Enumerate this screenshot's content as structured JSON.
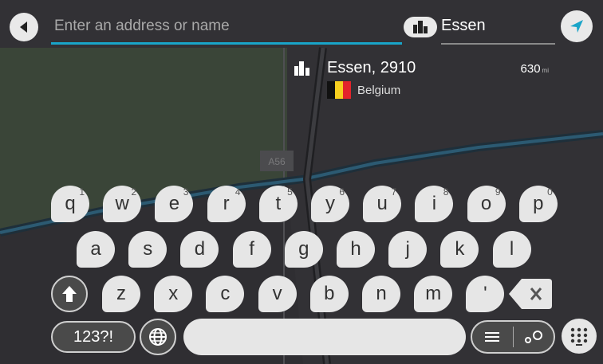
{
  "search": {
    "placeholder": "Enter an address or name"
  },
  "location": {
    "value": "Essen"
  },
  "result": {
    "title": "Essen, 2910",
    "country": "Belgium",
    "distance": "630",
    "distance_unit": "mi"
  },
  "map": {
    "road_label": "A56"
  },
  "keyboard": {
    "row1": [
      {
        "key": "q",
        "sup": "1"
      },
      {
        "key": "w",
        "sup": "2"
      },
      {
        "key": "e",
        "sup": "3"
      },
      {
        "key": "r",
        "sup": "4"
      },
      {
        "key": "t",
        "sup": "5"
      },
      {
        "key": "y",
        "sup": "6"
      },
      {
        "key": "u",
        "sup": "7"
      },
      {
        "key": "i",
        "sup": "8"
      },
      {
        "key": "o",
        "sup": "9"
      },
      {
        "key": "p",
        "sup": "0"
      }
    ],
    "row2": [
      "a",
      "s",
      "d",
      "f",
      "g",
      "h",
      "j",
      "k",
      "l"
    ],
    "row3": [
      "z",
      "x",
      "c",
      "v",
      "b",
      "n",
      "m",
      "'"
    ],
    "symbols_label": "123?!"
  },
  "colors": {
    "accent": "#19a4c8",
    "nav_arrow": "#19a4c8",
    "key_bg": "#e6e6e6",
    "dark_key": "#4a4a4a",
    "flag_black": "#111111",
    "flag_yellow": "#f7cf1f",
    "flag_red": "#e3242b"
  },
  "icons": {
    "back": "back-arrow-icon",
    "nav": "navigation-arrow-icon",
    "city": "city-icon",
    "shift": "shift-arrow-icon",
    "backspace": "backspace-icon",
    "globe": "globe-icon",
    "list": "list-icon",
    "map_pin": "map-pin-icon",
    "keyboard": "keyboard-icon"
  }
}
